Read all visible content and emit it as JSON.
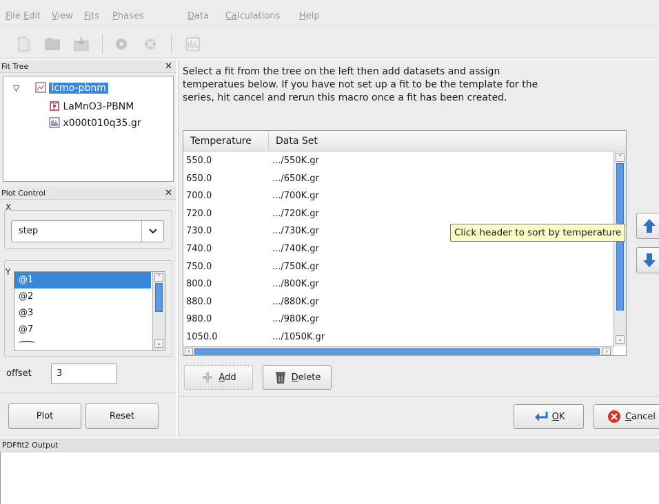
{
  "menu": {
    "items": [
      {
        "first": "F",
        "rest": "ile"
      },
      {
        "first": "E",
        "rest": "dit"
      },
      {
        "first": "V",
        "rest": "iew"
      },
      {
        "first": "Fi",
        "rest": "ts",
        "underline_first_only": "F"
      },
      {
        "first": "P",
        "rest": "hases"
      },
      {
        "first": "D",
        "rest": "ata"
      },
      {
        "first": "Ca",
        "rest": "lculations"
      },
      {
        "first": "H",
        "rest": "elp"
      }
    ],
    "labels": [
      "File",
      "Edit",
      "View",
      "Fits",
      "Phases",
      "Data",
      "Calculations",
      "Help"
    ]
  },
  "toolbar": {
    "icons": [
      "new-icon",
      "open-icon",
      "save-icon",
      "run-icon",
      "stop-icon",
      "plot-icon"
    ]
  },
  "fit_tree": {
    "title": "Fit Tree",
    "root": "lcmo-pbnm",
    "phase": "LaMnO3-PBNM",
    "dataset": "x000t010q35.gr"
  },
  "plot_control": {
    "title": "Plot Control",
    "x_label": "X",
    "x_value": "step",
    "y_label": "Y",
    "y_items": [
      "@1",
      "@2",
      "@3",
      "@7"
    ],
    "offset_label": "offset",
    "offset_value": "3",
    "plot_button": "Plot",
    "reset_button": "Reset"
  },
  "dialog": {
    "instructions": "Select a fit from the tree on the left then add datasets and assign temperatues below. If you have not set up a fit to be the template for the series, hit cancel and rerun this macro once a fit has been created.",
    "col_temperature": "Temperature",
    "col_dataset": "Data Set",
    "rows": [
      {
        "t": "550.0",
        "d": ".../550K.gr"
      },
      {
        "t": "650.0",
        "d": ".../650K.gr"
      },
      {
        "t": "700.0",
        "d": ".../700K.gr"
      },
      {
        "t": "720.0",
        "d": ".../720K.gr"
      },
      {
        "t": "730.0",
        "d": ".../730K.gr"
      },
      {
        "t": "740.0",
        "d": ".../740K.gr"
      },
      {
        "t": "750.0",
        "d": ".../750K.gr"
      },
      {
        "t": "800.0",
        "d": ".../800K.gr"
      },
      {
        "t": "880.0",
        "d": ".../880K.gr"
      },
      {
        "t": "980.0",
        "d": ".../980K.gr"
      },
      {
        "t": "1050.0",
        "d": ".../1050K.gr"
      }
    ],
    "tooltip": "Click header to sort by temperature",
    "add_first": "A",
    "add_rest": "dd",
    "delete_first": "D",
    "delete_rest": "elete",
    "ok_first": "O",
    "ok_rest": "K",
    "cancel_first": "C",
    "cancel_rest": "ancel"
  },
  "output": {
    "title": "PDFfit2 Output"
  },
  "colors": {
    "selection": "#3a87d8",
    "panel": "#ececec",
    "tooltip": "#fbfbc8",
    "cancel_red": "#d9312a"
  }
}
